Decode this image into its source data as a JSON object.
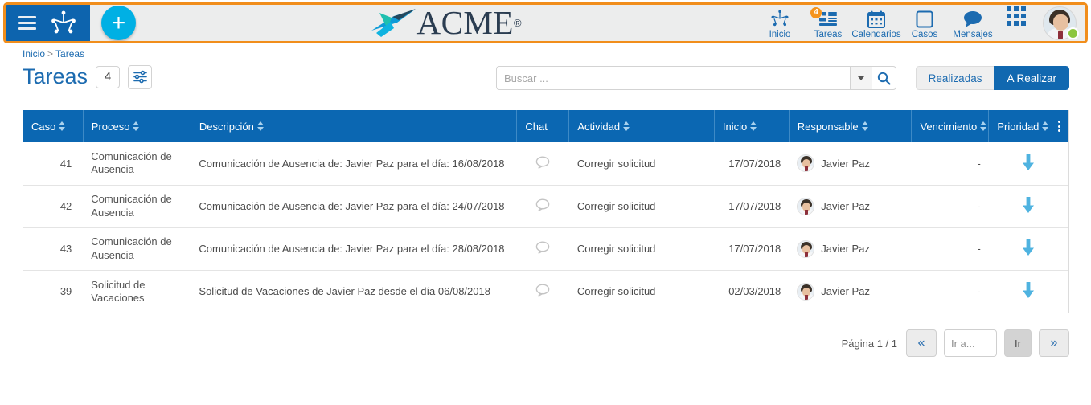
{
  "topbar": {
    "menu_icon": "hamburger-icon",
    "brand_icon": "paw-logo-icon",
    "add_label": "+",
    "logo_text": "ACME",
    "logo_registered": "®",
    "nav": [
      {
        "label": "Inicio",
        "icon": "paw-icon",
        "badge": ""
      },
      {
        "label": "Tareas",
        "icon": "tasks-icon",
        "badge": "4"
      },
      {
        "label": "Calendarios",
        "icon": "calendar-icon",
        "badge": ""
      },
      {
        "label": "Casos",
        "icon": "square-icon",
        "badge": ""
      },
      {
        "label": "Mensajes",
        "icon": "chat-icon",
        "badge": ""
      }
    ],
    "apps_icon": "app-grid-icon",
    "avatar_icon": "user-avatar",
    "status": "online"
  },
  "breadcrumb": {
    "home": "Inicio",
    "separator": ">",
    "current": "Tareas"
  },
  "page": {
    "title": "Tareas",
    "count": "4",
    "filter_icon": "filter-sliders-icon"
  },
  "search": {
    "placeholder": "Buscar ...",
    "value": "",
    "dropdown_icon": "chevron-down-icon",
    "search_icon": "magnifier-icon"
  },
  "toggle": {
    "done_label": "Realizadas",
    "todo_label": "A Realizar",
    "active": "A Realizar"
  },
  "table": {
    "columns": [
      {
        "label": "Caso",
        "sortable": true
      },
      {
        "label": "Proceso",
        "sortable": true
      },
      {
        "label": "Descripción",
        "sortable": true
      },
      {
        "label": "Chat",
        "sortable": false
      },
      {
        "label": "Actividad",
        "sortable": true
      },
      {
        "label": "Inicio",
        "sortable": true
      },
      {
        "label": "Responsable",
        "sortable": true
      },
      {
        "label": "Vencimiento",
        "sortable": true
      },
      {
        "label": "Prioridad",
        "sortable": true
      }
    ],
    "menu_icon": "kebab-menu-icon",
    "rows": [
      {
        "caso": "41",
        "proceso": "Comunicación de Ausencia",
        "descripcion": "Comunicación de Ausencia de: Javier Paz para el día: 16/08/2018",
        "chat_icon": "chat-bubble-icon",
        "actividad": "Corregir solicitud",
        "inicio": "17/07/2018",
        "responsable": "Javier Paz",
        "vencimiento": "-",
        "prioridad_icon": "arrow-down-icon"
      },
      {
        "caso": "42",
        "proceso": "Comunicación de Ausencia",
        "descripcion": "Comunicación de Ausencia de: Javier Paz para el día: 24/07/2018",
        "chat_icon": "chat-bubble-icon",
        "actividad": "Corregir solicitud",
        "inicio": "17/07/2018",
        "responsable": "Javier Paz",
        "vencimiento": "-",
        "prioridad_icon": "arrow-down-icon"
      },
      {
        "caso": "43",
        "proceso": "Comunicación de Ausencia",
        "descripcion": "Comunicación de Ausencia de: Javier Paz para el día: 28/08/2018",
        "chat_icon": "chat-bubble-icon",
        "actividad": "Corregir solicitud",
        "inicio": "17/07/2018",
        "responsable": "Javier Paz",
        "vencimiento": "-",
        "prioridad_icon": "arrow-down-icon"
      },
      {
        "caso": "39",
        "proceso": "Solicitud de Vacaciones",
        "descripcion": "Solicitud de Vacaciones de Javier  Paz desde el día 06/08/2018",
        "chat_icon": "chat-bubble-icon",
        "actividad": "Corregir solicitud",
        "inicio": "02/03/2018",
        "responsable": "Javier Paz",
        "vencimiento": "-",
        "prioridad_icon": "arrow-down-icon"
      }
    ]
  },
  "pagination": {
    "label": "Página 1 / 1",
    "first_icon": "«",
    "goto_placeholder": "Ir a...",
    "goto_value": "",
    "go_label": "Ir",
    "last_icon": "»"
  },
  "colors": {
    "brand_blue": "#0d64ae",
    "table_header_blue": "#0b67b2",
    "accent_orange": "#f18e1c",
    "cyan": "#00b0e4",
    "priority_arrow": "#4fb3e0",
    "status_green": "#8cc63e"
  }
}
